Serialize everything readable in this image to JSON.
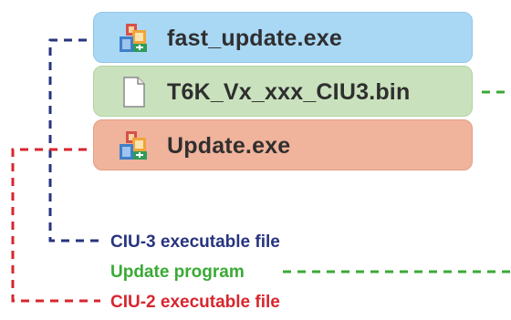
{
  "files": [
    {
      "name": "fast_update.exe",
      "icon": "installer-package-icon"
    },
    {
      "name": "T6K_Vx_xxx_CIU3.bin",
      "icon": "blank-document-icon"
    },
    {
      "name": "Update.exe",
      "icon": "installer-package-icon"
    }
  ],
  "legend": {
    "ciu3": "CIU-3 executable file",
    "update": "Update program",
    "ciu2": "CIU-2 executable file"
  },
  "colors": {
    "ciu3_line": "#27347e",
    "update_line": "#3aaa35",
    "ciu2_line": "#d7262e",
    "blue_box": "#a9d8f5",
    "green_box": "#c9e2bd",
    "red_box": "#f0b39b"
  }
}
